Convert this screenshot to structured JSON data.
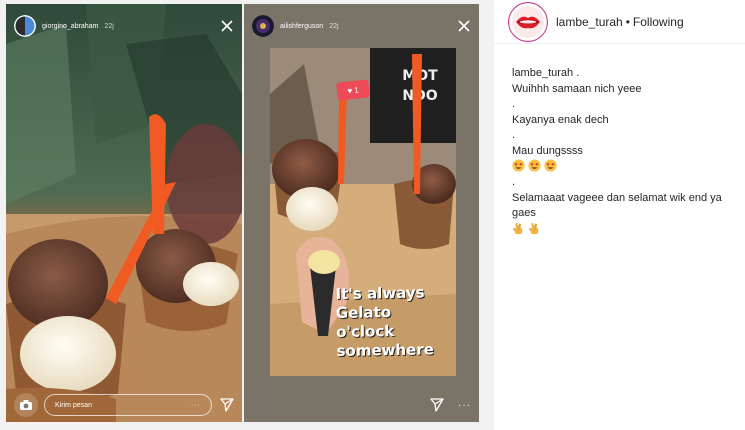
{
  "story_left": {
    "username": "giorgino_abraham",
    "time": "22j",
    "reply_placeholder": "Kirim pesan",
    "dots": "···"
  },
  "story_right": {
    "username": "ailishferguson",
    "time": "22j",
    "sticker_count": "1",
    "overlay_text": [
      "It's always",
      "Gelato",
      "o'clock",
      "somewhere"
    ],
    "dots": "···"
  },
  "post_header": {
    "username": "lambe_turah",
    "separator": "•",
    "follow_label": "Following"
  },
  "caption": {
    "username": "lambe_turah",
    "first_suffix": " .",
    "lines": [
      "Wuihhh samaan nich yeee",
      ".",
      "Kayanya enak dech",
      ".",
      "Mau dungssss"
    ],
    "emoji_line_1": [
      "star-struck-emoji",
      "star-struck-emoji",
      "star-struck-emoji"
    ],
    "lines_2": [
      ".",
      "Selamaaat vageee dan selamat wik end ya",
      "gaes"
    ],
    "emoji_line_2": [
      "fingers-crossed-emoji",
      "fingers-crossed-emoji"
    ]
  },
  "colors": {
    "heart_red": "#ed4956",
    "lips_red": "#d81f2a",
    "story_ring": "#c13584"
  }
}
